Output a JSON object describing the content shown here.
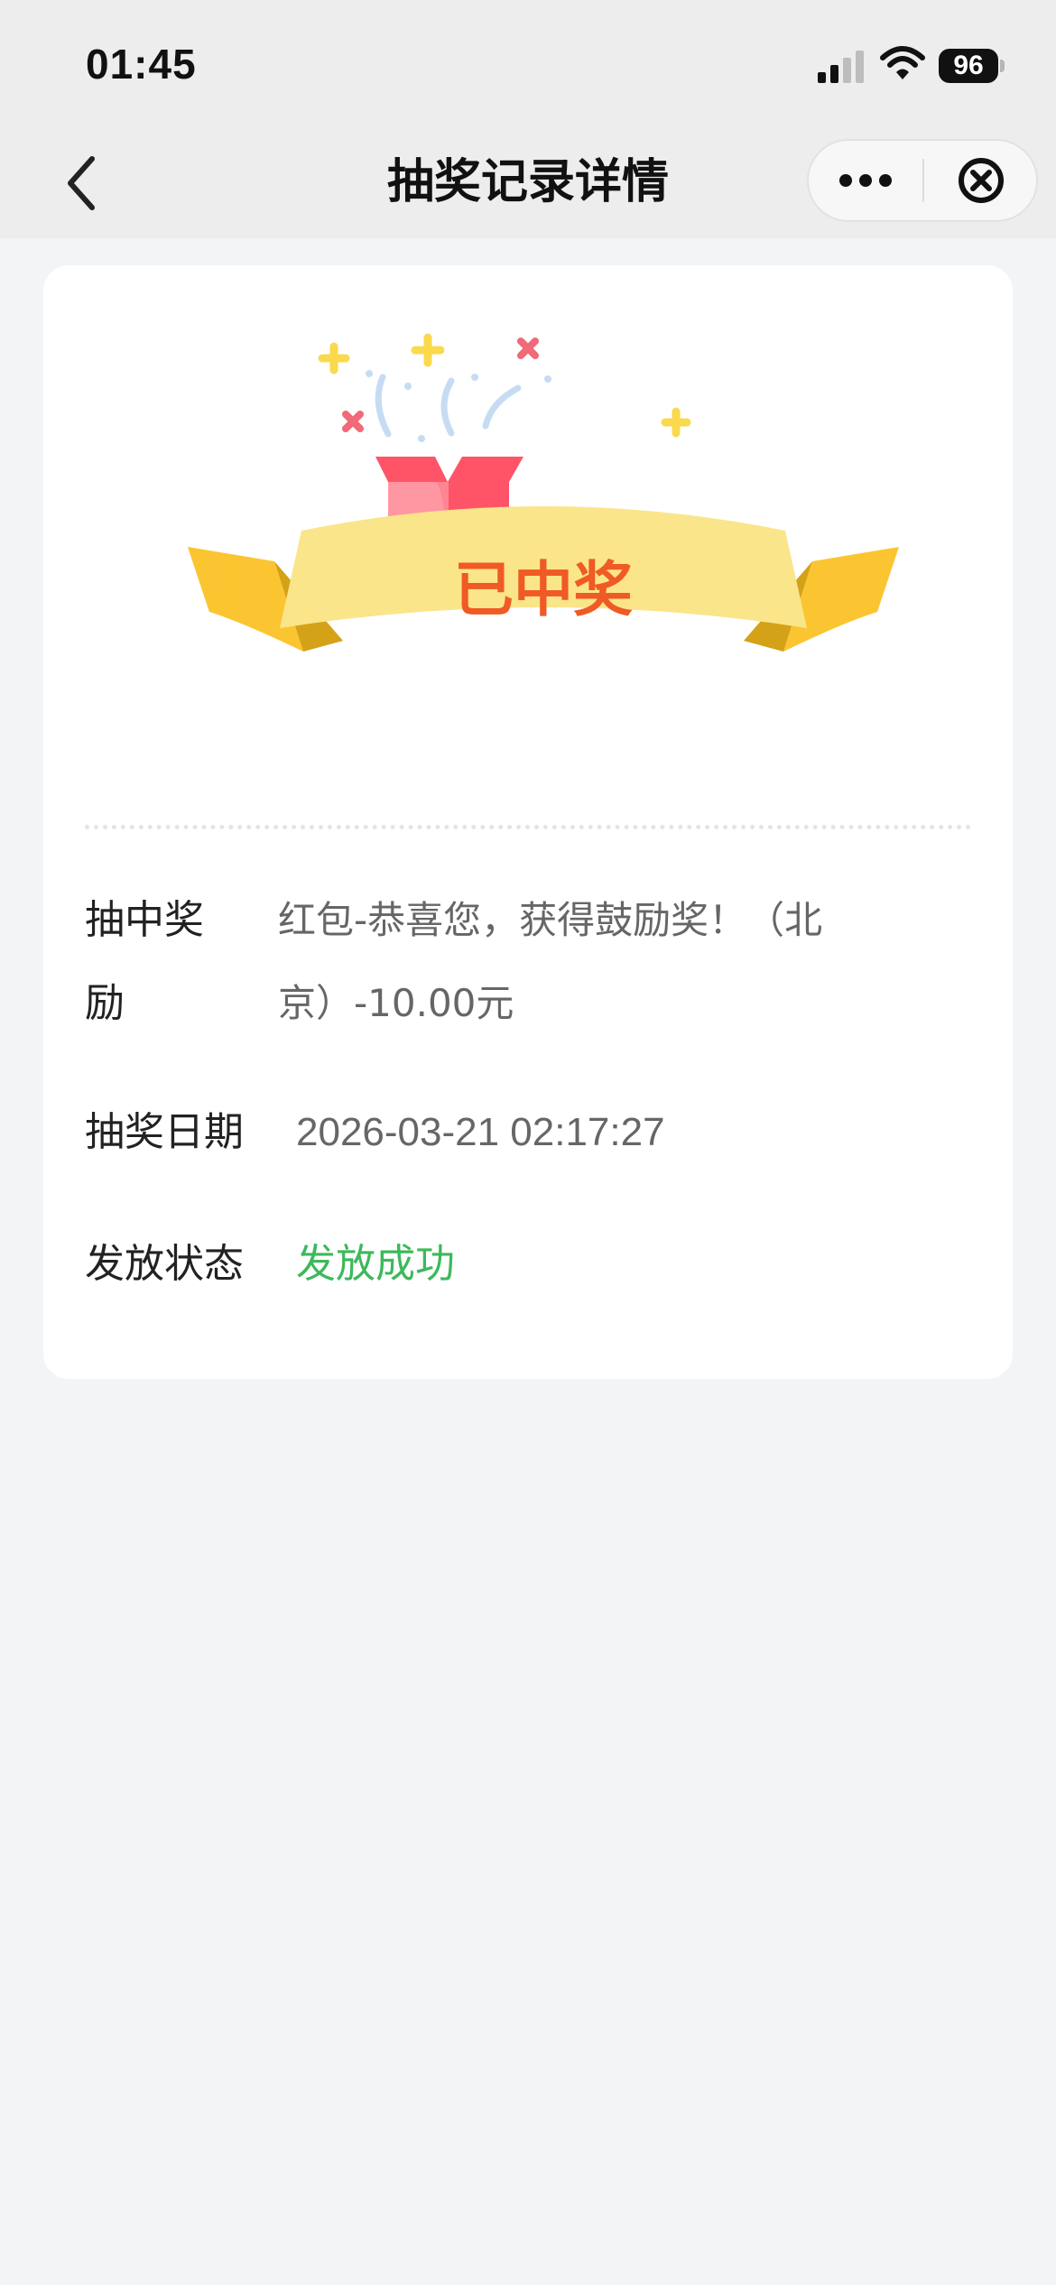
{
  "status_bar": {
    "time": "01:45",
    "battery_level": "96",
    "icons": [
      "signal-icon",
      "wifi-icon",
      "battery-icon"
    ]
  },
  "nav": {
    "title": "抽奖记录详情",
    "icons": [
      "back-icon",
      "more-icon",
      "close-icon"
    ]
  },
  "banner": {
    "text": "已中奖",
    "icons": [
      "gift-box-icon",
      "sparkle-icon"
    ],
    "colors": {
      "ribbon": "#fae58a",
      "ribbon_tail": "#fbc531",
      "text": "#f05a24",
      "box": "#ff5a6a"
    }
  },
  "details": {
    "reward_label": "抽中奖励",
    "reward_value": "红包-恭喜您，获得鼓励奖！（北京）-10.00元",
    "date_label": "抽奖日期",
    "date_value": "2026-03-21 02:17:27",
    "status_label": "发放状态",
    "status_value": "发放成功"
  },
  "colors": {
    "page_background": "#f3f4f6",
    "card_background": "#ffffff",
    "status_success": "#3cb95a"
  }
}
